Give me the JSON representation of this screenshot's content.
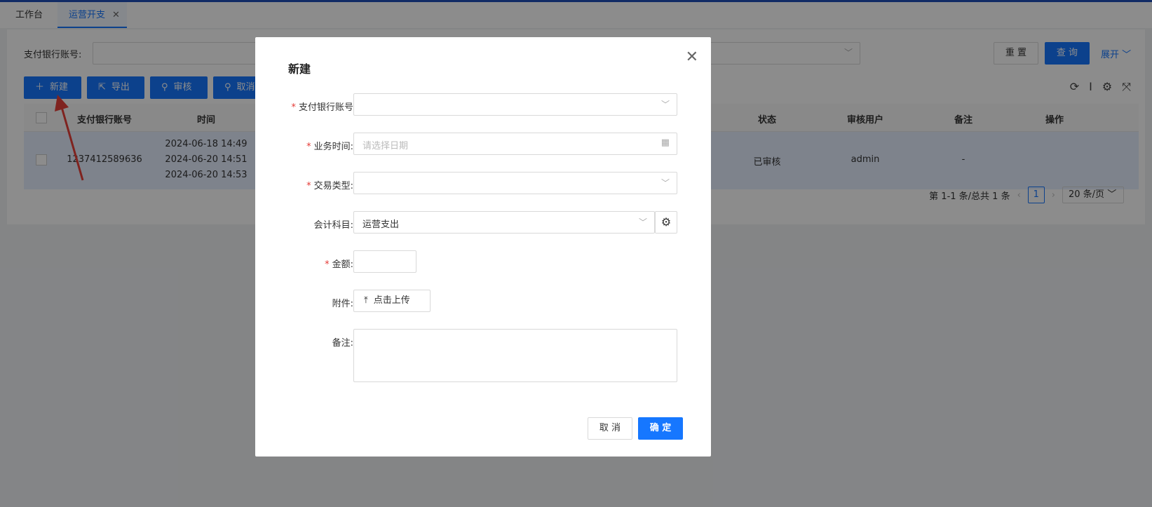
{
  "tabs": [
    {
      "label": "工作台"
    },
    {
      "label": "运营开支",
      "close": "✕"
    }
  ],
  "search": {
    "label": "支付银行账号:",
    "reset_label": "重 置",
    "query_label": "查 询",
    "expand_label": "展开"
  },
  "toolbar": {
    "new_label": "新建",
    "export_label": "导出",
    "audit_label": "审核",
    "cancel_label": "取消"
  },
  "table": {
    "columns": [
      "支付银行账号",
      "时间",
      "状态",
      "审核用户",
      "备注",
      "操作"
    ],
    "rows": [
      {
        "account": "1237412589636",
        "times": [
          "2024-06-18 14:49",
          "2024-06-20 14:51",
          "2024-06-20 14:53"
        ],
        "status": "已审核",
        "audit_user": "admin",
        "remark": "-"
      }
    ]
  },
  "pager": {
    "summary": "第 1-1 条/总共 1 条",
    "current_page": "1",
    "page_size": "20 条/页"
  },
  "modal": {
    "title": "新建",
    "fields": {
      "account_label": "支付银行账号",
      "biz_time_label": "业务时间:",
      "biz_time_placeholder": "请选择日期",
      "trade_type_label": "交易类型:",
      "subject_label": "会计科目:",
      "subject_value": "运营支出",
      "amount_label": "金额:",
      "attachment_label": "附件:",
      "upload_label": "点击上传",
      "remark_label": "备注:"
    },
    "cancel_label": "取 消",
    "ok_label": "确 定"
  },
  "colors": {
    "primary": "#1677ff",
    "required": "#e53935",
    "annotation_arrow": "#e8413a"
  }
}
